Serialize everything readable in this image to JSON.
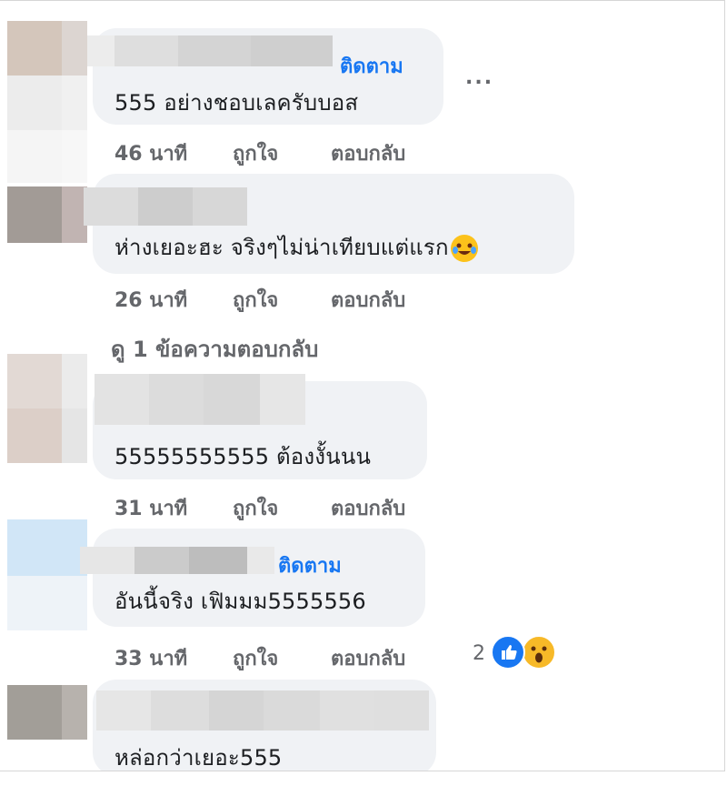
{
  "ui": {
    "accent": "#1877f2",
    "meta_color": "#65676b",
    "bubble_bg": "#f0f2f5"
  },
  "comments": [
    {
      "text": "555 อย่างชอบเลครับบอส",
      "follow": "ติดตาม",
      "time": "46 นาที",
      "like": "ถูกใจ",
      "reply": "ตอบกลับ",
      "more": "..."
    },
    {
      "text": "ห่างเยอะฮะ จริงๆไม่น่าเทียบแต่แรก",
      "emoji": "rolling-on-floor-laughing-emoji",
      "time": "26 นาที",
      "like": "ถูกใจ",
      "reply": "ตอบกลับ"
    },
    {
      "text": "55555555555 ต้องงั้นนน",
      "time": "31 นาที",
      "like": "ถูกใจ",
      "reply": "ตอบกลับ"
    },
    {
      "text": "อันนี้จริง เฟิมมม5555556",
      "follow": "ติดตาม",
      "time": "33 นาที",
      "like": "ถูกใจ",
      "reply": "ตอบกลับ",
      "reaction_count": "2",
      "reactions": [
        "like-icon",
        "wow-icon"
      ]
    },
    {
      "text": "หล่อกว่าเยอะ555"
    }
  ],
  "view_replies": "ดู 1 ข้อความตอบกลับ"
}
